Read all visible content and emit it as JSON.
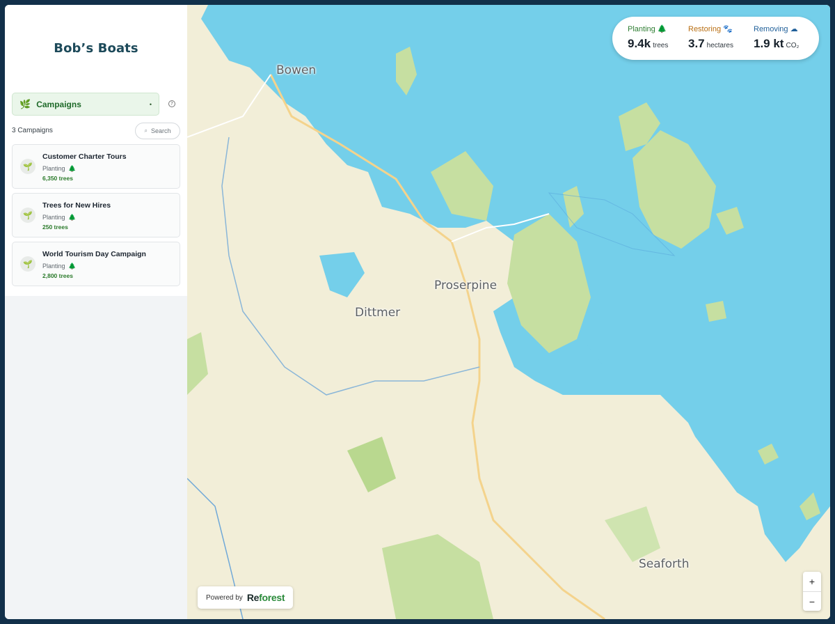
{
  "sidebar": {
    "brand": "Bob’s Boats",
    "campaign_select": {
      "label": "Campaigns",
      "caret": "•"
    },
    "help": "?",
    "count": "3 Campaigns",
    "search_label": "Search",
    "campaigns": [
      {
        "title": "Customer Charter Tours",
        "type": "Planting",
        "trees": "6,350 trees"
      },
      {
        "title": "Trees for New Hires",
        "type": "Planting",
        "trees": "250 trees"
      },
      {
        "title": "World Tourism Day Campaign",
        "type": "Planting",
        "trees": "2,800 trees"
      }
    ]
  },
  "map": {
    "places": {
      "bowen": "Bowen",
      "proserpine": "Proserpine",
      "dittmer": "Dittmer",
      "seaforth": "Seaforth"
    },
    "stats": {
      "planting": {
        "label": "Planting",
        "value": "9.4k",
        "unit": "trees",
        "color": "#2e7d32"
      },
      "restoring": {
        "label": "Restoring",
        "value": "3.7",
        "unit": "hectares",
        "color": "#b86e12"
      },
      "removing": {
        "label": "Removing",
        "value": "1.9 kt",
        "unit": "CO₂",
        "color": "#1f5f99"
      }
    },
    "zoom": {
      "in": "+",
      "out": "−"
    },
    "powered": {
      "prefix": "Powered by",
      "logo_a": "Re",
      "logo_b": "forest"
    },
    "colors": {
      "water": "#74cfea",
      "land": "#f2eed8",
      "vegetation": "#c6dfa1",
      "road": "#f4d38c"
    }
  }
}
